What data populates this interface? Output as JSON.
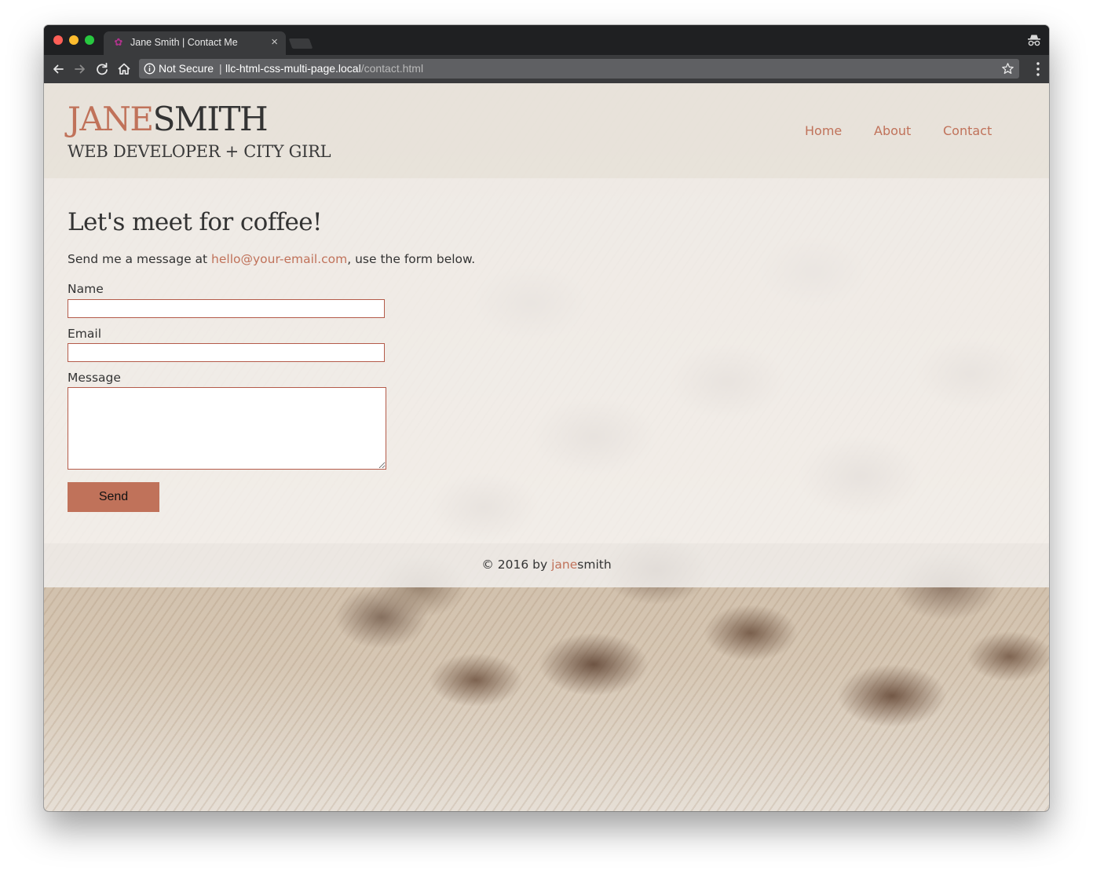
{
  "browser": {
    "tab_title": "Jane Smith | Contact Me",
    "tab_close": "×",
    "security_label": "Not Secure",
    "url_separator": "|",
    "url_host": "llc-html-css-multi-page.local",
    "url_path": "/contact.html"
  },
  "site": {
    "logo_first": "JANE",
    "logo_last": "SMITH",
    "tagline": "WEB DEVELOPER + CITY GIRL",
    "nav": {
      "home": "Home",
      "about": "About",
      "contact": "Contact"
    }
  },
  "contact": {
    "heading": "Let's meet for coffee!",
    "intro_before": "Send me a message at ",
    "email": "hello@your-email.com",
    "intro_after": ", use the form below.",
    "name_label": "Name",
    "name_value": "",
    "email_label": "Email",
    "email_value": "",
    "message_label": "Message",
    "message_value": "",
    "send_label": "Send"
  },
  "footer": {
    "prefix": "© 2016 by ",
    "first": "jane",
    "last": "smith"
  },
  "colors": {
    "accent": "#c0725a",
    "text": "#333333",
    "input_border": "#b45b4a"
  }
}
